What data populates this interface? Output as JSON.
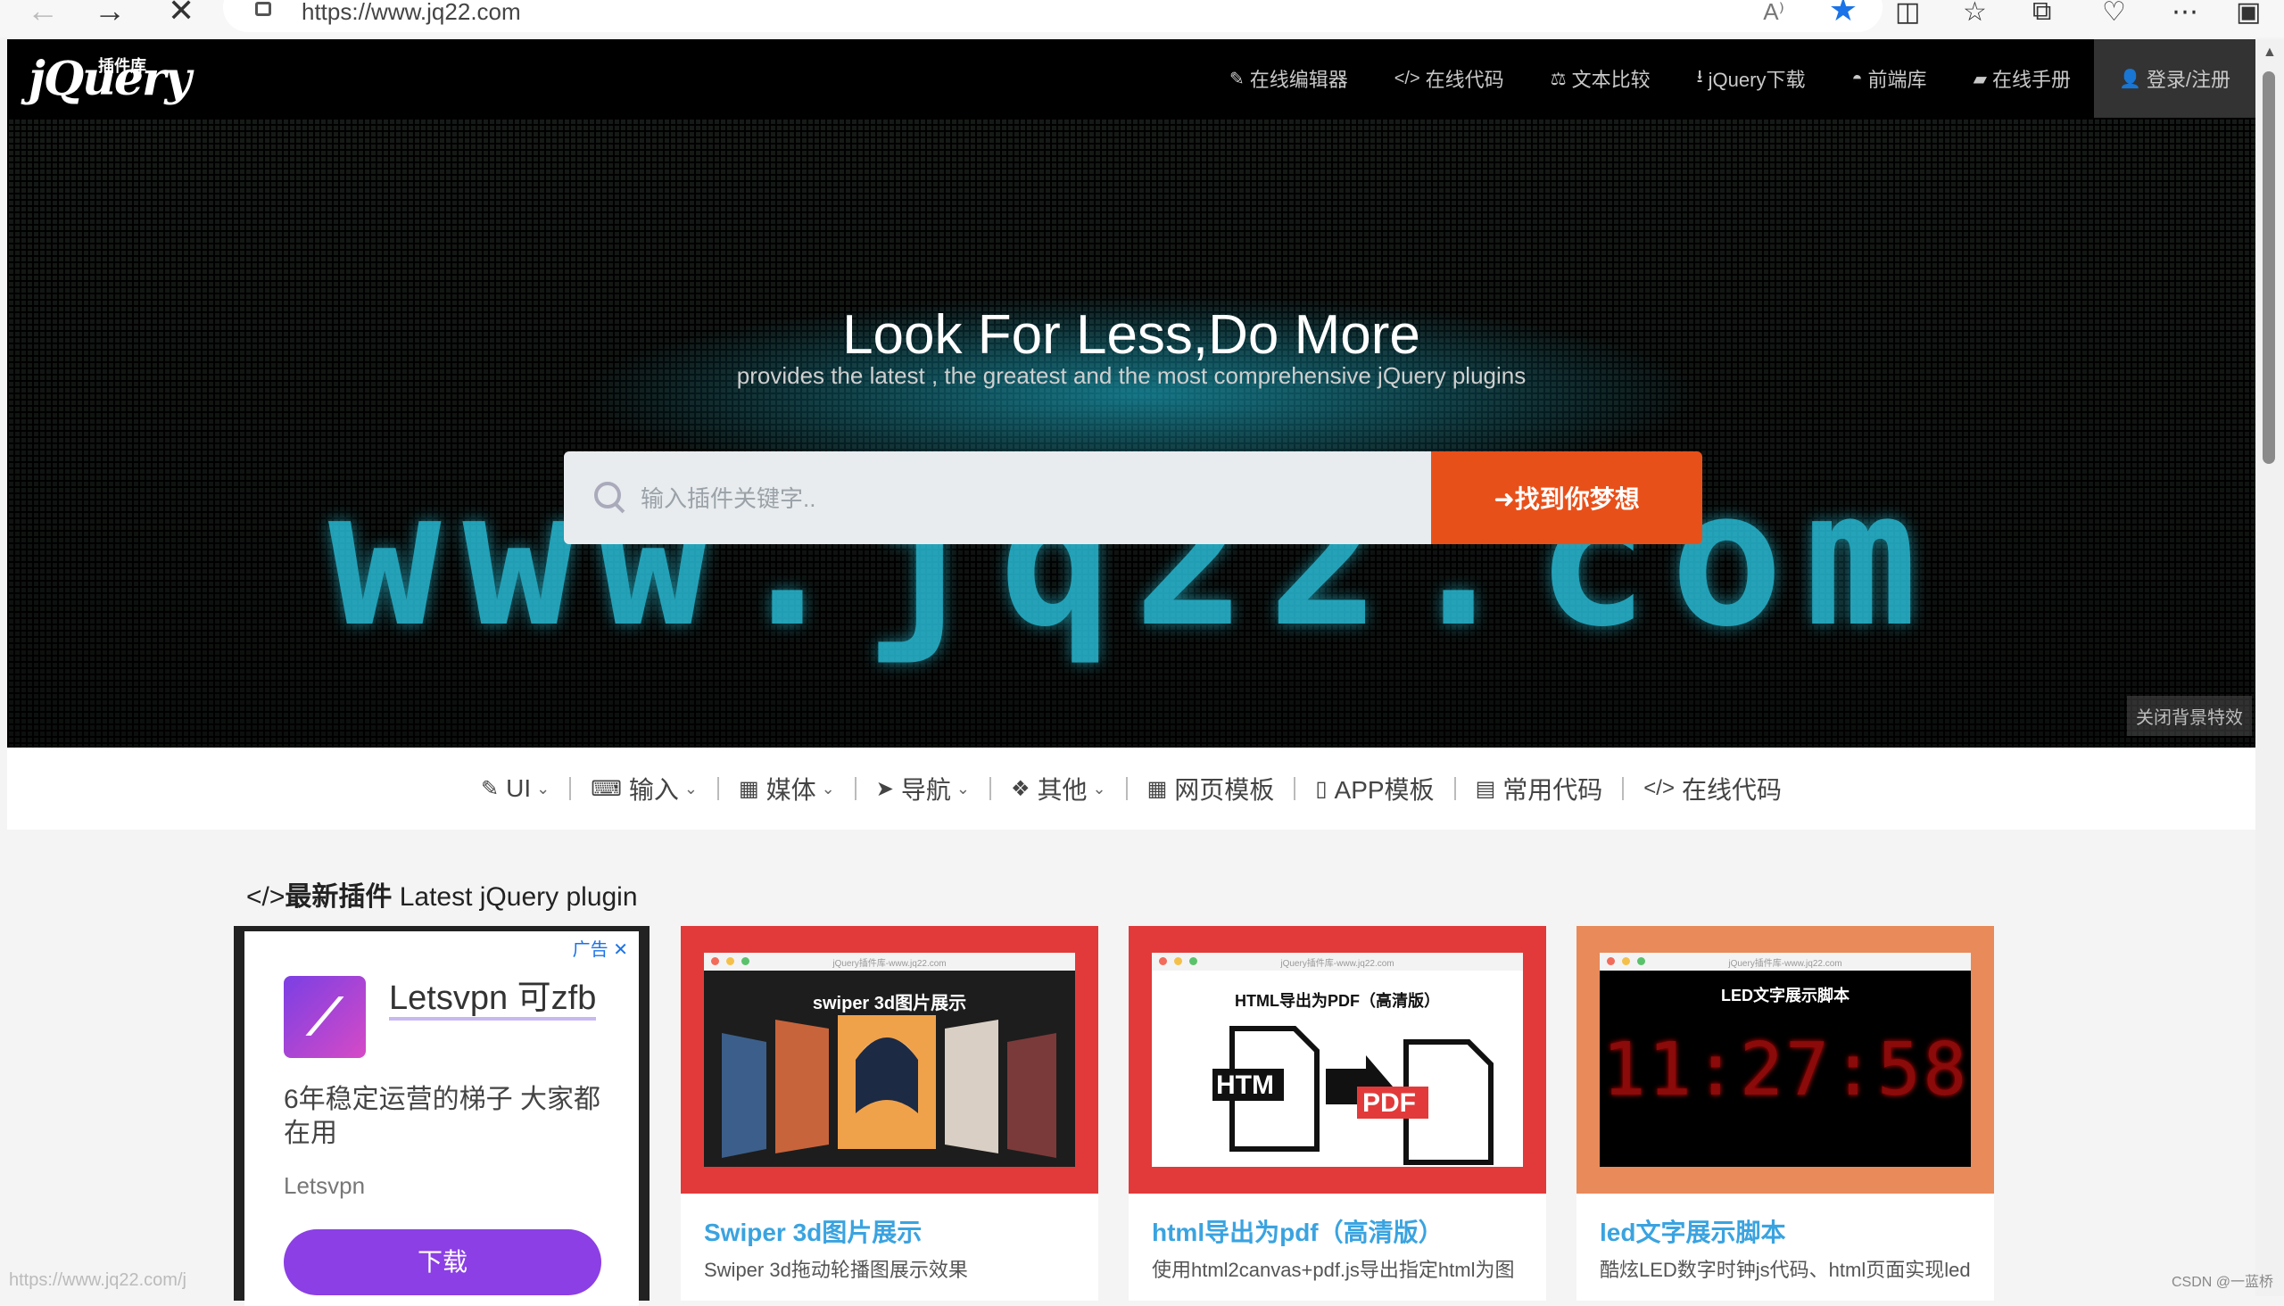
{
  "browser": {
    "url": "https://www.jq22.com",
    "read_aloud": "A⁾",
    "icons": [
      "back-icon",
      "forward-icon",
      "stop-icon",
      "lock-icon",
      "star-icon",
      "split-screen-icon",
      "favorites-icon",
      "collections-icon",
      "extensions-icon",
      "more-icon",
      "sidebar-icon"
    ]
  },
  "site": {
    "logo": "jQuery",
    "logo_sub": "插件库",
    "nav": [
      {
        "icon": "✎",
        "label": "在线编辑器"
      },
      {
        "icon": "</>",
        "label": "在线代码"
      },
      {
        "icon": "⚖",
        "label": "文本比较"
      },
      {
        "icon": "⭳",
        "label": "jQuery下载"
      },
      {
        "icon": "◓",
        "label": "前端库"
      },
      {
        "icon": "▰",
        "label": "在线手册"
      },
      {
        "icon": "👤",
        "label": "登录/注册"
      }
    ]
  },
  "hero": {
    "led_text": "www.jq22.com",
    "title": "Look For Less,Do More",
    "subtitle": "provides the latest , the greatest and the most comprehensive jQuery plugins",
    "search_placeholder": "输入插件关键字..",
    "search_button": "➜找到你梦想",
    "close_effect": "关闭背景特效"
  },
  "categories": [
    {
      "icon": "✎",
      "label": "UI",
      "dropdown": true
    },
    {
      "icon": "⌨",
      "label": "输入",
      "dropdown": true
    },
    {
      "icon": "▦",
      "label": "媒体",
      "dropdown": true
    },
    {
      "icon": "➤",
      "label": "导航",
      "dropdown": true
    },
    {
      "icon": "❖",
      "label": "其他",
      "dropdown": true
    },
    {
      "icon": "▦",
      "label": "网页模板",
      "dropdown": false
    },
    {
      "icon": "▯",
      "label": "APP模板",
      "dropdown": false
    },
    {
      "icon": "▤",
      "label": "常用代码",
      "dropdown": false
    },
    {
      "icon": "</>",
      "label": "在线代码",
      "dropdown": false
    }
  ],
  "section": {
    "icon": "</>",
    "title_bold": "最新插件",
    "title_rest": " Latest jQuery plugin"
  },
  "ad": {
    "tag": "广告 ✕",
    "logo_glyph": "⟋",
    "title": "Letsvpn 可zfb",
    "subtitle": "6年稳定运营的梯子 大家都在用",
    "brand": "Letsvpn",
    "button": "下载"
  },
  "cards": [
    {
      "bg": "#e23a3a",
      "frame_title": "swiper 3d图片展示",
      "title": "Swiper 3d图片展示",
      "desc": "Swiper 3d拖动轮播图展示效果",
      "frame_bar": "jQuery插件库-www.jq22.com"
    },
    {
      "bg": "#e23a3a",
      "frame_title": "HTML导出为PDF（高清版）",
      "title": "html导出为pdf（高清版）",
      "desc": "使用html2canvas+pdf.js导出指定html为图",
      "frame_bar": "jQuery插件库-www.jq22.com"
    },
    {
      "bg": "#e88a5a",
      "frame_title": "LED文字展示脚本",
      "title": "led文字展示脚本",
      "desc": "酷炫LED数字时钟js代码、html页面实现led",
      "frame_bar": "jQuery插件库-www.jq22.com",
      "clock": "11:27:58"
    }
  ],
  "status_url": "https://www.jq22.com/j",
  "watermark": "CSDN @一蓝桥"
}
